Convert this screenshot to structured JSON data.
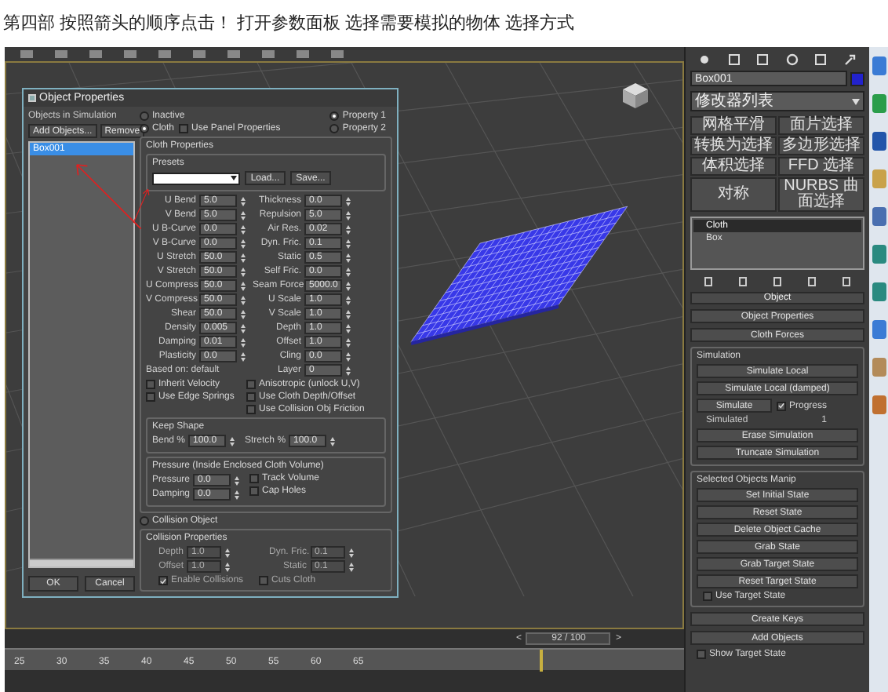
{
  "caption": "第四部 按照箭头的顺序点击！ 打开参数面板 选择需要模拟的物体 选择方式",
  "dialog": {
    "title": "Object Properties",
    "objects_label": "Objects in Simulation",
    "list_buttons": [
      "Add Objects...",
      "Remove"
    ],
    "objects": [
      {
        "label": "Box001",
        "selected": true
      }
    ],
    "footer_buttons": [
      "OK",
      "Cancel"
    ],
    "type_radios": [
      {
        "label": "Inactive",
        "selected": false
      },
      {
        "label": "Cloth",
        "selected": true
      }
    ],
    "use_panel": {
      "label": "Use Panel Properties",
      "checked": false
    },
    "property_radios": [
      {
        "label": "Property 1",
        "selected": true
      },
      {
        "label": "Property 2",
        "selected": false
      }
    ],
    "cloth_properties": {
      "title": "Cloth Properties",
      "presets_title": "Presets",
      "preset_buttons": [
        "Load...",
        "Save..."
      ],
      "left_params": [
        {
          "label": "U Bend",
          "value": "5.0"
        },
        {
          "label": "V Bend",
          "value": "5.0"
        },
        {
          "label": "U B-Curve",
          "value": "0.0"
        },
        {
          "label": "V B-Curve",
          "value": "0.0"
        },
        {
          "label": "U Stretch",
          "value": "50.0"
        },
        {
          "label": "V Stretch",
          "value": "50.0"
        },
        {
          "label": "U Compress",
          "value": "50.0"
        },
        {
          "label": "V Compress",
          "value": "50.0"
        },
        {
          "label": "Shear",
          "value": "50.0"
        },
        {
          "label": "Density",
          "value": "0.005"
        },
        {
          "label": "Damping",
          "value": "0.01"
        },
        {
          "label": "Plasticity",
          "value": "0.0"
        }
      ],
      "right_params": [
        {
          "label": "Thickness",
          "value": "0.0"
        },
        {
          "label": "Repulsion",
          "value": "5.0"
        },
        {
          "label": "Air Res.",
          "value": "0.02"
        },
        {
          "label": "Dyn. Fric.",
          "value": "0.1"
        },
        {
          "label": "Static",
          "value": "0.5"
        },
        {
          "label": "Self Fric.",
          "value": "0.0"
        },
        {
          "label": "Seam Force",
          "value": "5000.0"
        },
        {
          "label": "U Scale",
          "value": "1.0"
        },
        {
          "label": "V Scale",
          "value": "1.0"
        },
        {
          "label": "Depth",
          "value": "1.0"
        },
        {
          "label": "Offset",
          "value": "1.0"
        },
        {
          "label": "Cling",
          "value": "0.0"
        },
        {
          "label": "Layer",
          "value": "0"
        }
      ],
      "based_on": "Based on: default",
      "options_left": [
        {
          "label": "Inherit Velocity",
          "checked": false
        },
        {
          "label": "Use Edge Springs",
          "checked": false
        }
      ],
      "options_right": [
        {
          "label": "Anisotropic (unlock U,V)",
          "checked": false
        },
        {
          "label": "Use Cloth Depth/Offset",
          "checked": false
        },
        {
          "label": "Use Collision Obj Friction",
          "checked": false
        }
      ],
      "keep_shape": {
        "title": "Keep Shape",
        "fields": [
          {
            "label": "Bend %",
            "value": "100.0"
          },
          {
            "label": "Stretch %",
            "value": "100.0"
          }
        ]
      },
      "pressure": {
        "title": "Pressure (Inside Enclosed Cloth Volume)",
        "fields": [
          {
            "label": "Pressure",
            "value": "0.0"
          },
          {
            "label": "Damping",
            "value": "0.0"
          }
        ],
        "checks": [
          {
            "label": "Track Volume",
            "checked": false
          },
          {
            "label": "Cap Holes",
            "checked": false
          }
        ]
      }
    },
    "collision_radio": {
      "label": "Collision Object",
      "selected": false
    },
    "collision_properties": {
      "title": "Collision Properties",
      "disabled": true,
      "fields": [
        {
          "label": "Depth",
          "value": "1.0"
        },
        {
          "label": "Dyn. Fric.",
          "value": "0.1"
        },
        {
          "label": "Offset",
          "value": "1.0"
        },
        {
          "label": "Static",
          "value": "0.1"
        }
      ],
      "checks": [
        {
          "label": "Enable Collisions",
          "checked": true
        },
        {
          "label": "Cuts Cloth",
          "checked": false
        }
      ]
    }
  },
  "command_panel": {
    "object_name": "Box001",
    "modifier_list": "修改器列表",
    "modifier_buttons": [
      "网格平滑",
      "面片选择",
      "转换为选择",
      "多边形选择",
      "体积选择",
      "FFD 选择",
      "对称",
      "NURBS 曲面选择"
    ],
    "stack": [
      {
        "label": "Cloth",
        "selected": true
      },
      {
        "label": "Box",
        "selected": false
      }
    ],
    "rollout_title": "Object",
    "object_buttons": [
      "Object Properties",
      "Cloth Forces"
    ],
    "sections": [
      {
        "title": "Simulation",
        "items": [
          {
            "kind": "button",
            "label": "Simulate Local"
          },
          {
            "kind": "button",
            "label": "Simulate Local (damped)"
          },
          {
            "kind": "button_check",
            "label": "Simulate",
            "check_label": "Progress",
            "checked": true
          },
          {
            "kind": "readout",
            "label": "Simulated",
            "value": "1"
          },
          {
            "kind": "button",
            "label": "Erase Simulation"
          },
          {
            "kind": "button",
            "label": "Truncate Simulation"
          }
        ]
      },
      {
        "title": "Selected Objects Manip",
        "items": [
          {
            "kind": "button",
            "label": "Set Initial State"
          },
          {
            "kind": "button",
            "label": "Reset State"
          },
          {
            "kind": "button",
            "label": "Delete Object Cache"
          },
          {
            "kind": "button",
            "label": "Grab State"
          },
          {
            "kind": "button",
            "label": "Grab Target State"
          },
          {
            "kind": "button",
            "label": "Reset Target State"
          },
          {
            "kind": "check",
            "label": "Use Target State",
            "checked": false
          }
        ]
      }
    ],
    "bottom_items": [
      {
        "kind": "button",
        "label": "Create Keys"
      },
      {
        "kind": "button",
        "label": "Add Objects"
      },
      {
        "kind": "check",
        "label": "Show Target State",
        "checked": false
      }
    ]
  },
  "timeline": {
    "ticks": [
      "25",
      "30",
      "35",
      "40",
      "45",
      "50",
      "55",
      "60",
      "65"
    ],
    "prev": "<",
    "frame": "92 / 100",
    "next": ">"
  }
}
